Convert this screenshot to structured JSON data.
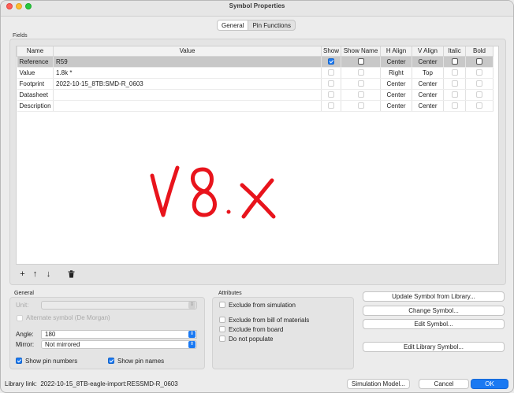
{
  "window": {
    "title": "Symbol Properties"
  },
  "tabs": [
    {
      "label": "General",
      "active": true
    },
    {
      "label": "Pin Functions",
      "active": false
    }
  ],
  "fields": {
    "group_label": "Fields",
    "columns": [
      "Name",
      "Value",
      "Show",
      "Show Name",
      "H Align",
      "V Align",
      "Italic",
      "Bold"
    ],
    "rows": [
      {
        "name": "Reference",
        "value": "R59",
        "show": true,
        "show_name": false,
        "h_align": "Center",
        "v_align": "Center",
        "italic": false,
        "bold": false,
        "selected": true
      },
      {
        "name": "Value",
        "value": "1.8k *",
        "show": false,
        "show_name": false,
        "h_align": "Right",
        "v_align": "Top",
        "italic": false,
        "bold": false,
        "selected": false
      },
      {
        "name": "Footprint",
        "value": "2022-10-15_8TB:SMD-R_0603",
        "show": false,
        "show_name": false,
        "h_align": "Center",
        "v_align": "Center",
        "italic": false,
        "bold": false,
        "selected": false
      },
      {
        "name": "Datasheet",
        "value": "",
        "show": false,
        "show_name": false,
        "h_align": "Center",
        "v_align": "Center",
        "italic": false,
        "bold": false,
        "selected": false
      },
      {
        "name": "Description",
        "value": "",
        "show": false,
        "show_name": false,
        "h_align": "Center",
        "v_align": "Center",
        "italic": false,
        "bold": false,
        "selected": false
      }
    ],
    "toolbar_icons": [
      "plus-icon",
      "arrow-up-icon",
      "arrow-down-icon",
      "trash-icon"
    ]
  },
  "annotation": {
    "text": "V8.x",
    "color": "#e8141c"
  },
  "general": {
    "group_label": "General",
    "unit_label": "Unit:",
    "unit_value": "",
    "alternate_label": "Alternate symbol (De Morgan)",
    "angle_label": "Angle:",
    "angle_value": "180",
    "mirror_label": "Mirror:",
    "mirror_value": "Not mirrored",
    "show_pin_numbers_label": "Show pin numbers",
    "show_pin_names_label": "Show pin names"
  },
  "attributes": {
    "group_label": "Attributes",
    "exclude_sim": "Exclude from simulation",
    "exclude_bom": "Exclude from bill of materials",
    "exclude_board": "Exclude from board",
    "do_not_populate": "Do not populate"
  },
  "actions": {
    "update_symbol": "Update Symbol from Library...",
    "change_symbol": "Change Symbol...",
    "edit_symbol": "Edit Symbol...",
    "edit_library_symbol": "Edit Library Symbol..."
  },
  "footer": {
    "library_link_label": "Library link:",
    "library_link_value": "2022-10-15_8TB-eagle-import:RESSMD-R_0603",
    "simulation_model": "Simulation Model...",
    "cancel": "Cancel",
    "ok": "OK"
  },
  "colors": {
    "accent": "#1a79f2",
    "selected_row": "#c8c8c8"
  }
}
